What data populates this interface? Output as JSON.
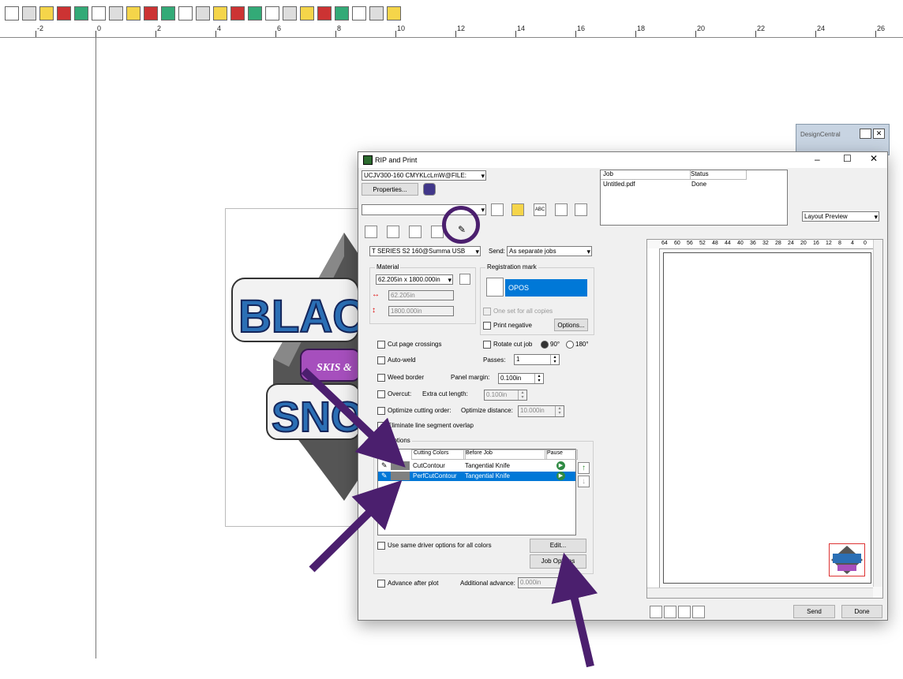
{
  "toolbar": {
    "icons": [
      "rip-icon",
      "pen-icon",
      "marker-icon",
      "cut-icon",
      "copy-icon",
      "paste-icon",
      "undo-icon",
      "redo-icon",
      "zoom-icon",
      "layout-icon",
      "grid-icon",
      "printer-icon",
      "color-icon",
      "search-icon",
      "palette-icon",
      "swatch-icon",
      "fx-icon",
      "gradient-icon",
      "lines-icon",
      "pencil-icon",
      "cloud-icon",
      "upload-icon",
      "box-icon"
    ]
  },
  "ruler": {
    "labels": [
      "-2",
      "0",
      "2",
      "4",
      "6",
      "8",
      "10",
      "12",
      "14",
      "16",
      "18",
      "20",
      "22",
      "24",
      "26"
    ]
  },
  "design_central": {
    "title": "DesignCentral"
  },
  "artwork": {
    "line1": "BLACK",
    "line2": "SKIS &",
    "line3": "SNO"
  },
  "dialog": {
    "title": "RIP and Print",
    "printer": "UCJV300-160 CMYKLcLmW@FILE:",
    "properties_label": "Properties...",
    "job_table": {
      "headers": [
        "Job",
        "Status"
      ],
      "rows": [
        [
          "Untitled.pdf",
          "Done"
        ]
      ]
    },
    "layout_select": "Layout Preview",
    "cutter": "T SERIES S2 160@Summa USB",
    "send_label": "Send:",
    "send_value": "As separate jobs",
    "material_label": "Material",
    "material_value": "62.205in x 1800.000in",
    "width_value": "62.205in",
    "height_value": "1800.000in",
    "registration_label": "Registration mark",
    "registration_value": "OPOS",
    "one_set_label": "One set for all copies",
    "print_negative_label": "Print negative",
    "options_label": "Options...",
    "cut_page_label": "Cut page crossings",
    "rotate_label": "Rotate cut job",
    "rot90": "90°",
    "rot180": "180°",
    "auto_weld_label": "Auto-weld",
    "passes_label": "Passes:",
    "passes_value": "1",
    "weed_label": "Weed border",
    "panel_margin_label": "Panel margin:",
    "panel_margin_value": "0.100in",
    "overcut_label": "Overcut:",
    "extra_cut_label": "Extra cut length:",
    "extra_cut_value": "0.100in",
    "optimize_label": "Optimize cutting order:",
    "optimize_dist_label": "Optimize distance:",
    "optimize_dist_value": "10.000in",
    "eliminate_label": "Eliminate line segment overlap",
    "tool_options_label": "options",
    "tool_headers": [
      "Cutting Colors",
      "Before Job",
      "Pause"
    ],
    "tool_rows": [
      {
        "color": "CutContour",
        "tool": "Tangential Knife"
      },
      {
        "color": "PerfCutContour",
        "tool": "Tangential Knife"
      }
    ],
    "same_driver_label": "Use same driver options for all colors",
    "edit_label": "Edit...",
    "job_options_label": "Job Options",
    "advance_label": "Advance after plot",
    "additional_advance_label": "Additional advance:",
    "additional_advance_value": "0.000in",
    "send_button": "Send",
    "done_button": "Done",
    "preview_ruler": [
      "64",
      "60",
      "56",
      "52",
      "48",
      "44",
      "40",
      "36",
      "32",
      "28",
      "24",
      "20",
      "16",
      "12",
      "8",
      "4",
      "0"
    ]
  },
  "colors": {
    "accent": "#0078d7",
    "arrow": "#4b1f6e"
  }
}
